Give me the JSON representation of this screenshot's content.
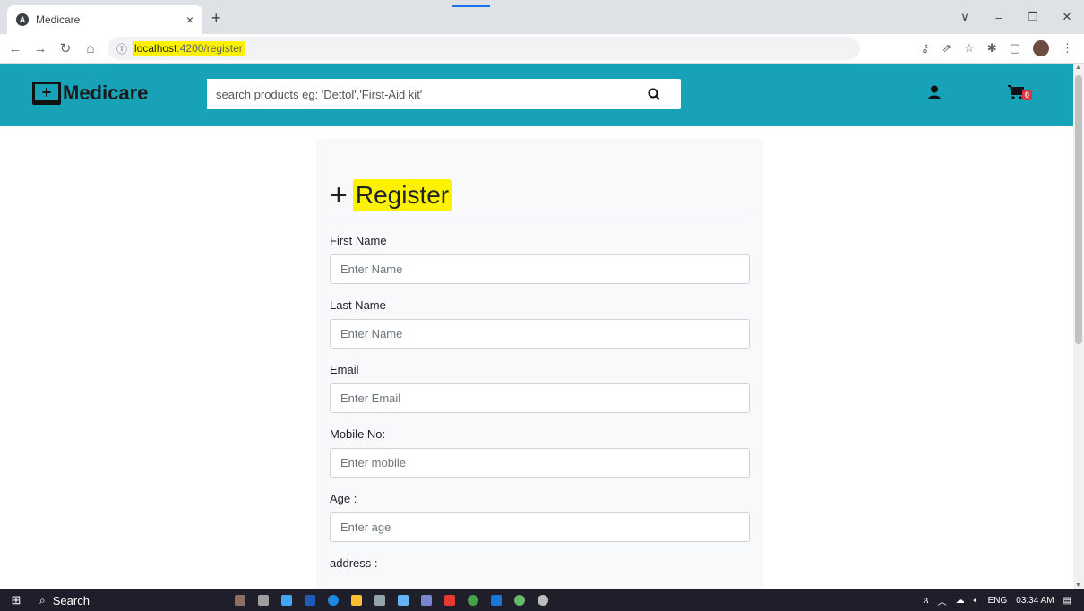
{
  "browser": {
    "tab_title": "Medicare",
    "tab_close": "×",
    "new_tab": "+",
    "url_host": "localhost",
    "url_path": ":4200/register",
    "window_controls": [
      "∨",
      "–",
      "❐",
      "✕"
    ]
  },
  "header": {
    "brand_name": "Medicare",
    "search_placeholder": "search products eg: 'Dettol','First-Aid kit'",
    "cart_count": "0",
    "color": "#17a2b8"
  },
  "form": {
    "title": "Register",
    "fields": [
      {
        "label": "First Name",
        "placeholder": "Enter Name"
      },
      {
        "label": "Last Name",
        "placeholder": "Enter Name"
      },
      {
        "label": "Email",
        "placeholder": "Enter Email"
      },
      {
        "label": "Mobile No:",
        "placeholder": "Enter mobile"
      },
      {
        "label": "Age :",
        "placeholder": "Enter age"
      },
      {
        "label": "address :"
      }
    ]
  },
  "taskbar": {
    "search_label": "Search",
    "language": "ENG",
    "time": "03:34 AM"
  }
}
